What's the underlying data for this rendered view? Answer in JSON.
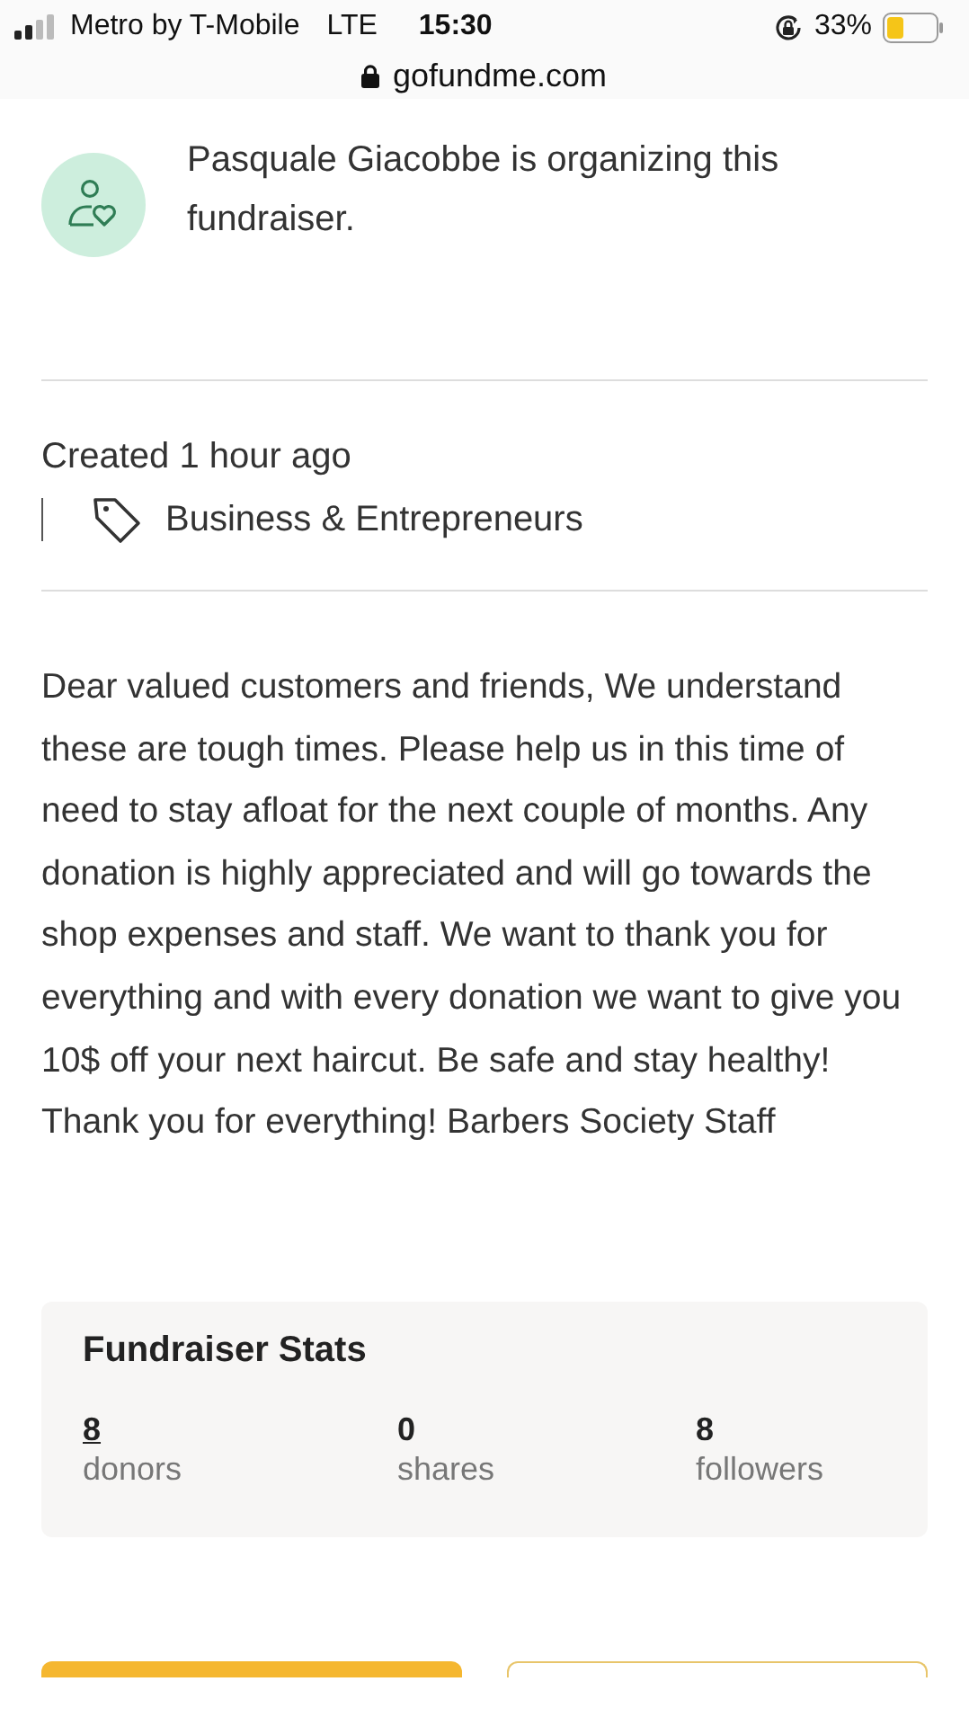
{
  "status_bar": {
    "carrier": "Metro by T-Mobile",
    "network": "LTE",
    "time": "15:30",
    "battery": "33%"
  },
  "address_bar": {
    "url": "gofundme.com"
  },
  "organizer": {
    "text": "Pasquale Giacobbe is organizing this fundraiser."
  },
  "meta": {
    "created": "Created 1 hour ago",
    "category": "Business & Entrepreneurs"
  },
  "story": "Dear valued customers and friends, We understand these are tough times. Please help us in this time of need to stay afloat for the next couple of months. Any donation is highly appreciated and will go towards the shop expenses and staff. We want to thank you for everything and with every donation we want to give you 10$ off your next haircut. Be safe and stay healthy! Thank you for everything! Barbers Society Staff",
  "stats": {
    "title": "Fundraiser Stats",
    "items": [
      {
        "value": "8",
        "label": "donors",
        "kind": "link"
      },
      {
        "value": "0",
        "label": "shares",
        "kind": "plain"
      },
      {
        "value": "8",
        "label": "followers",
        "kind": "plain"
      }
    ]
  },
  "bottom_buttons": [
    {
      "kind": "filled"
    },
    {
      "kind": "outline"
    }
  ]
}
